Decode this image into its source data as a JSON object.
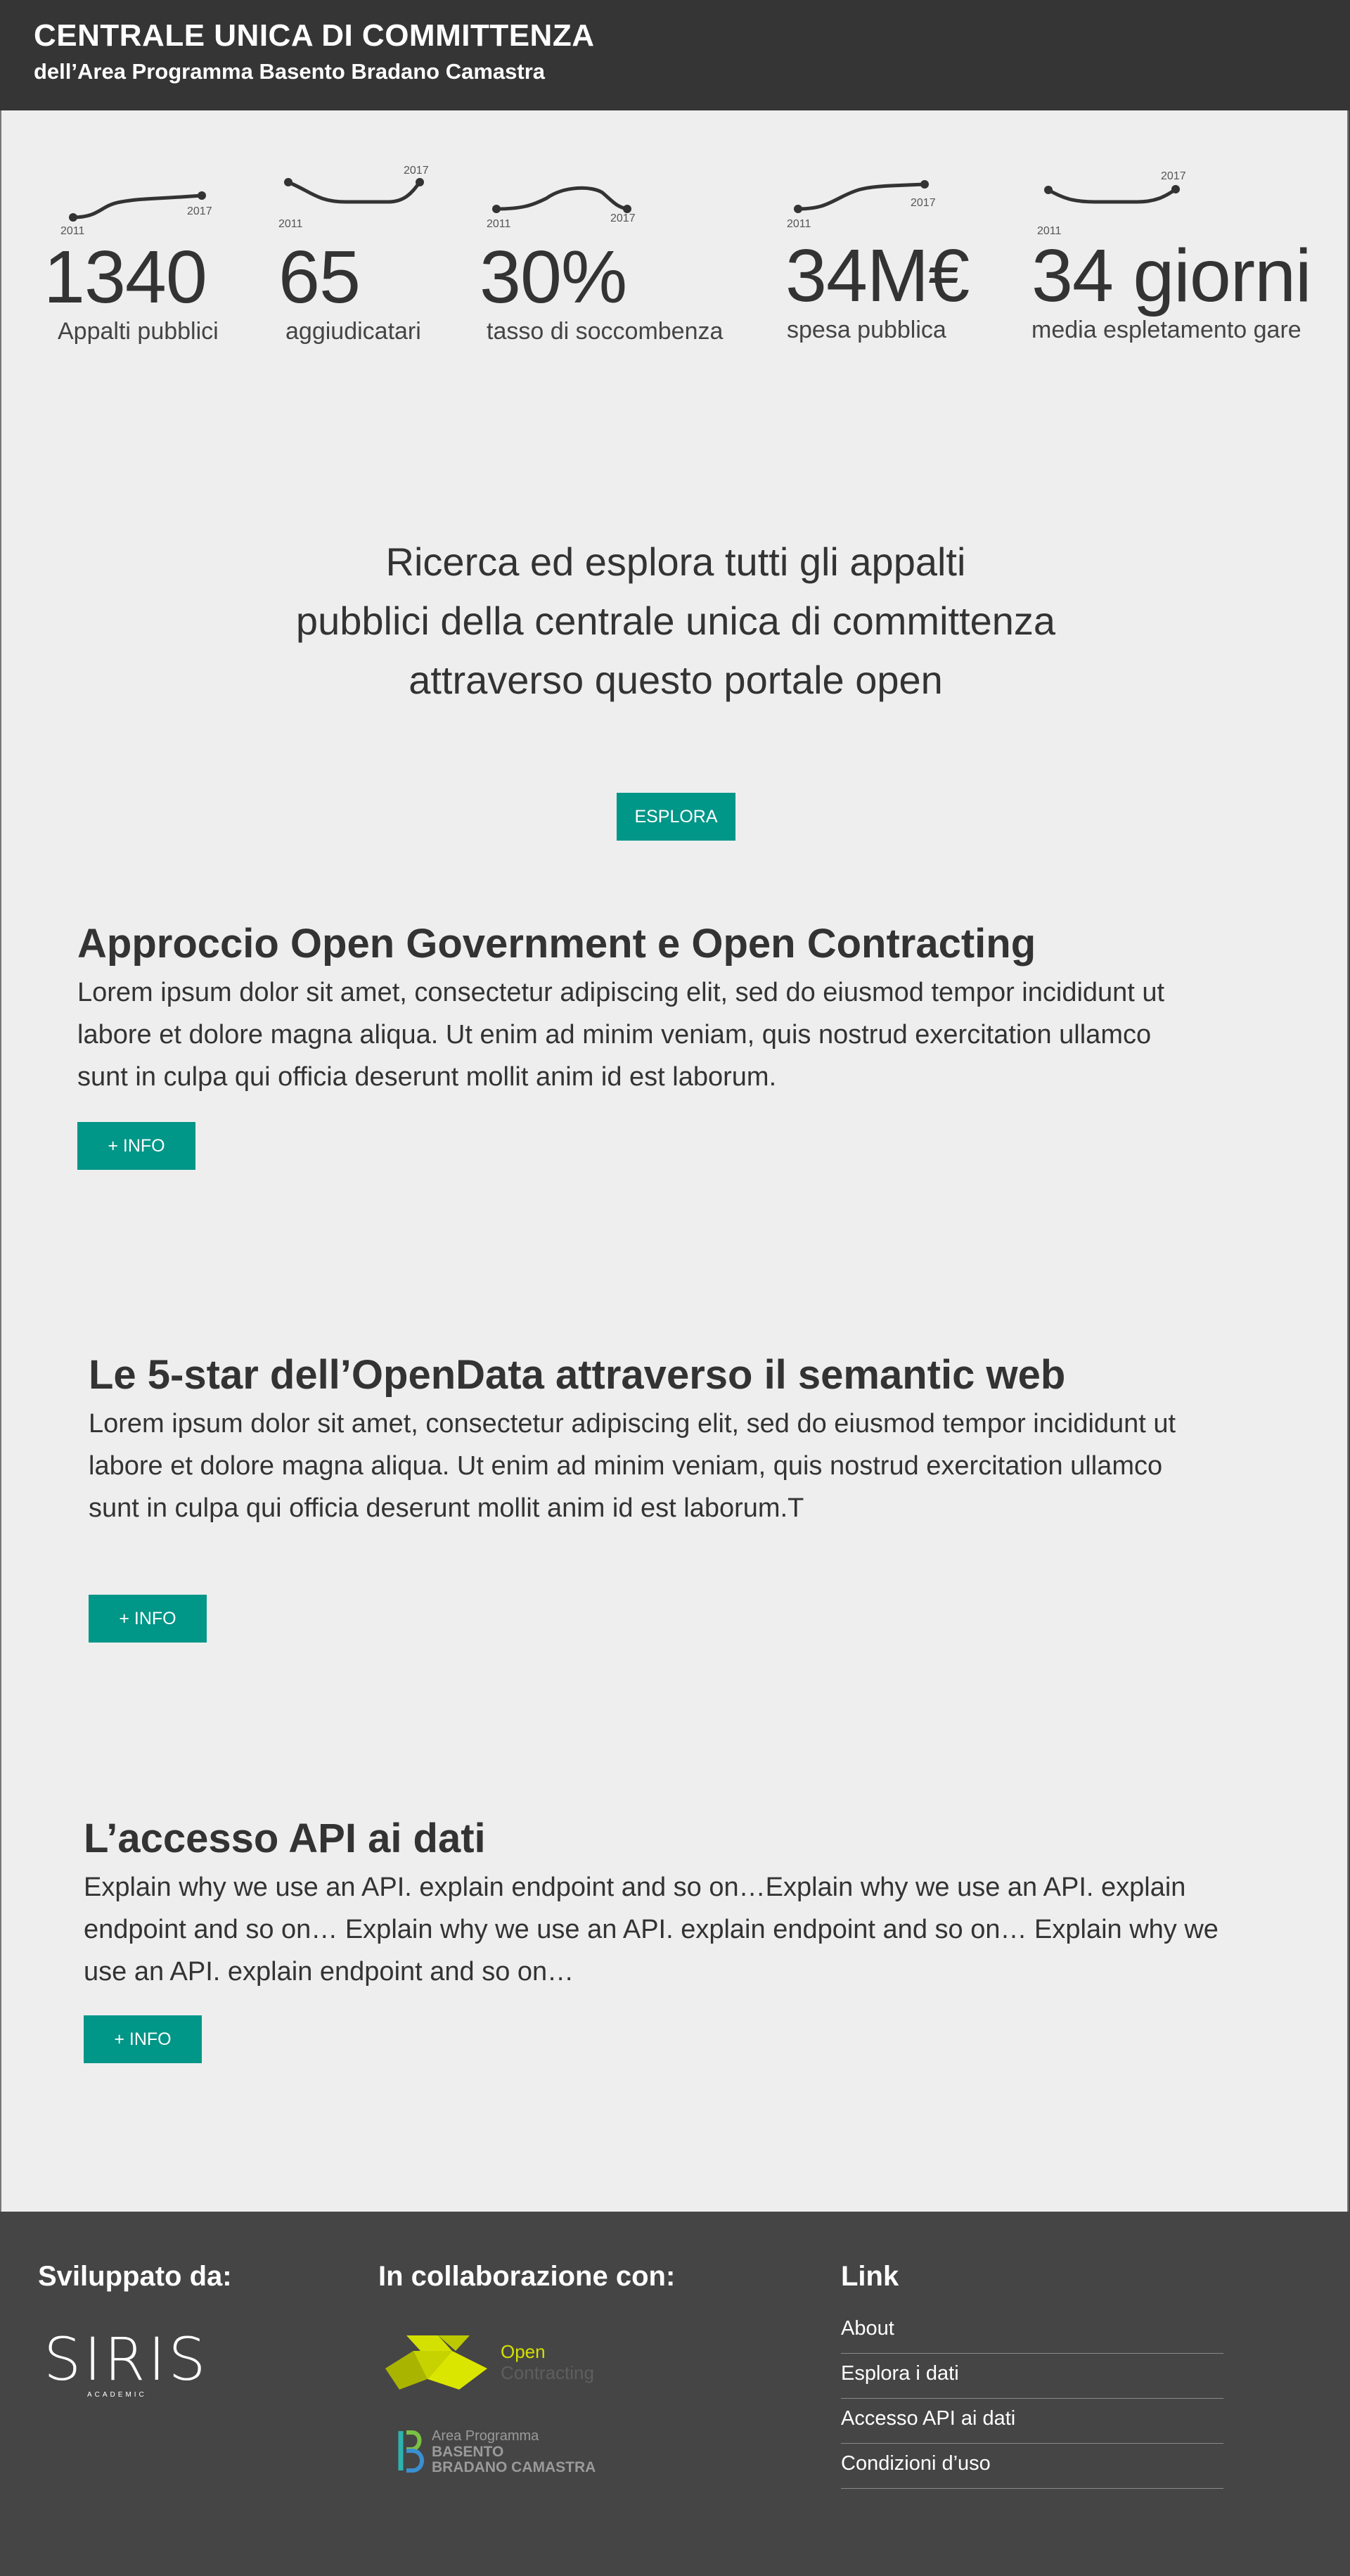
{
  "header": {
    "title": "CENTRALE UNICA DI COMMITTENZA",
    "subtitle": "dell’Area Programma Basento Bradano Camastra"
  },
  "stats": [
    {
      "value": "1340",
      "label": "Appalti pubblici",
      "year_start": "2011",
      "year_end": "2017"
    },
    {
      "value": "65",
      "label": "aggiudicatari",
      "year_start": "2011",
      "year_end": "2017"
    },
    {
      "value": "30%",
      "label": "tasso di soccombenza",
      "year_start": "2011",
      "year_end": "2017"
    },
    {
      "value": "34M€",
      "label": "spesa pubblica",
      "year_start": "2011",
      "year_end": "2017"
    },
    {
      "value": "34 giorni",
      "label": "media espletamento gare",
      "year_start": "2011",
      "year_end": "2017"
    }
  ],
  "intro": {
    "line1": "Ricerca ed esplora tutti gli appalti",
    "line2": "pubblici della centrale unica di committenza",
    "line3": "attraverso questo portale open",
    "button": "ESPLORA"
  },
  "sections": [
    {
      "title": "Approccio Open Government e Open Contracting",
      "line1": "Lorem ipsum dolor sit amet, consectetur adipiscing elit, sed do eiusmod tempor incididunt ut",
      "line2": "labore et dolore magna aliqua. Ut enim ad minim veniam, quis nostrud exercitation ullamco",
      "line3": "sunt in culpa qui officia deserunt mollit anim id est laborum.",
      "button": "+ INFO"
    },
    {
      "title": "Le 5-star dell’OpenData attraverso il semantic web",
      "line1": "Lorem ipsum dolor sit amet, consectetur adipiscing elit, sed do eiusmod tempor incididunt ut",
      "line2": "labore et dolore magna aliqua. Ut enim ad minim veniam, quis nostrud exercitation ullamco",
      "line3": "sunt in culpa qui officia deserunt mollit anim id est laborum.T",
      "button": "+ INFO"
    },
    {
      "title": "L’accesso API ai dati",
      "line1": "Explain why we use an API. explain endpoint and so on…Explain why we use an API. explain",
      "line2": "endpoint and so on… Explain why we use an API. explain endpoint and so on… Explain why we",
      "line3": "use an API. explain endpoint and so on…",
      "button": "+ INFO"
    }
  ],
  "footer": {
    "developed_by": "Sviluppato da:",
    "collab": "In collaborazione con:",
    "links_title": "Link",
    "links": [
      "About",
      "Esplora i dati",
      "Accesso API ai dati",
      "Condizioni d’uso"
    ],
    "logos": {
      "siris": "SIRIS",
      "siris_sub": "ACADEMIC",
      "open_contracting_1": "Open",
      "open_contracting_2": "Contracting",
      "area_1": "Area Programma",
      "area_2": "BASENTO",
      "area_3": "BRADANO CAMASTRA"
    }
  },
  "colors": {
    "header_bg": "#353535",
    "accent": "#009688",
    "footer_bg": "#454545",
    "page_bg": "#eeeeee"
  }
}
